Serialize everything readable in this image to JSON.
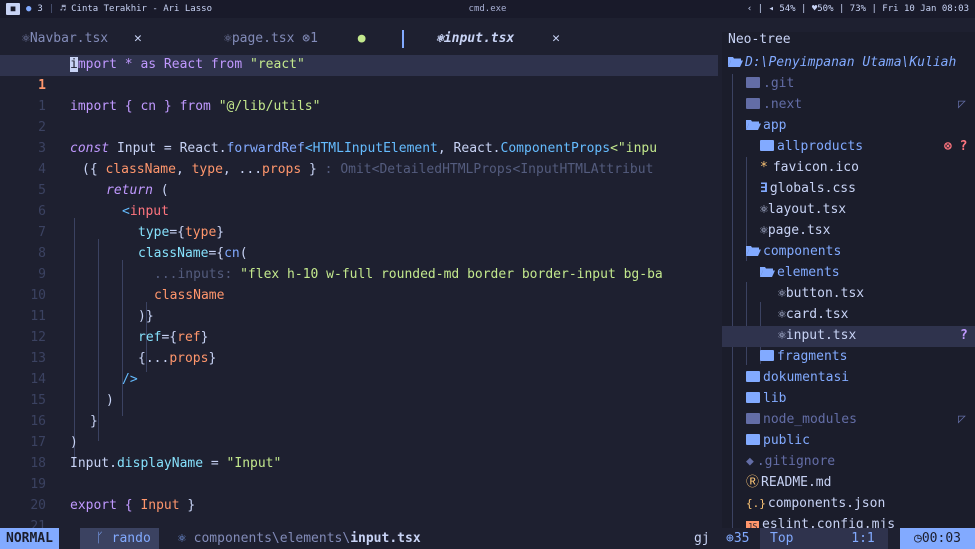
{
  "topbar": {
    "app_icon": "■",
    "dot_icon": "●",
    "workspace": "3",
    "music": "♬ Cinta Terakhir - Ari Lasso",
    "window_title": "cmd.exe",
    "status": "‹ | ◂ 54% | ♥50% | 73% | Fri 10 Jan 08:03"
  },
  "tabs": [
    {
      "icon": "⚛",
      "label": "Navbar.tsx",
      "close": "✕"
    },
    {
      "icon": "⚛",
      "label": "page.tsx",
      "badge": "⊗1",
      "modified": "●"
    },
    {
      "icon": "⚛",
      "label": "input.tsx",
      "close": "✕"
    }
  ],
  "editor": {
    "line_numbers": [
      "1",
      "1",
      "2",
      "3",
      "4",
      "5",
      "6",
      "7",
      "8",
      "9",
      "10",
      "11",
      "12",
      "13",
      "14",
      "15",
      "16",
      "17",
      "18",
      "19",
      "20",
      "21"
    ],
    "l1a": "i",
    "l1b": "mport * as React from ",
    "l1c": "\"react\"",
    "l3a": "import { cn } from ",
    "l3b": "\"@/lib/utils\"",
    "l5a": "const",
    "l5b": " Input = React.",
    "l5c": "forwardRef",
    "l5d": "<",
    "l5e": "HTMLInputElement",
    "l5f": ", React.",
    "l5g": "ComponentProps",
    "l5h": "<\"inpu",
    "l6a": "({ ",
    "l6b": "className",
    "l6c": ", ",
    "l6d": "type",
    "l6e": ", ...",
    "l6f": "props",
    "l6g": " } ",
    "l6h": ": Omit<DetailedHTMLProps<InputHTMLAttribut",
    "l7a": "return",
    "l7b": " (",
    "l8a": "<",
    "l8b": "input",
    "l9a": "type",
    "l9b": "={",
    "l9c": "type",
    "l9d": "}",
    "l10a": "className",
    "l10b": "={",
    "l10c": "cn",
    "l10d": "(",
    "l11a": "...inputs: ",
    "l11b": "\"flex h-10 w-full rounded-md border border-input bg-ba",
    "l12a": "className",
    "l13a": ")}",
    "l14a": "ref",
    "l14b": "={",
    "l14c": "ref",
    "l14d": "}",
    "l15a": "{...",
    "l15b": "props",
    "l15c": "}",
    "l16a": "/>",
    "l17a": ")",
    "l18a": "}",
    "l19a": ")",
    "l20a": "Input.",
    "l20b": "displayName",
    "l20c": " = ",
    "l20d": "\"Input\"",
    "l22a": "export { ",
    "l22b": "Input",
    "l22c": " }"
  },
  "tree": {
    "title": "Neo-tree",
    "root": "D:\\Penyimpanan Utama\\Kuliah",
    "items": [
      {
        "label": ".git"
      },
      {
        "label": ".next"
      },
      {
        "label": "app"
      },
      {
        "label": "allproducts"
      },
      {
        "label": "favicon.ico"
      },
      {
        "label": "globals.css"
      },
      {
        "label": "layout.tsx"
      },
      {
        "label": "page.tsx"
      },
      {
        "label": "components"
      },
      {
        "label": "elements"
      },
      {
        "label": "button.tsx"
      },
      {
        "label": "card.tsx"
      },
      {
        "label": "input.tsx"
      },
      {
        "label": "fragments"
      },
      {
        "label": "dokumentasi"
      },
      {
        "label": "lib"
      },
      {
        "label": "node_modules"
      },
      {
        "label": "public"
      },
      {
        "label": ".gitignore"
      },
      {
        "label": "README.md"
      },
      {
        "label": "components.json"
      },
      {
        "label": "eslint.config.mjs"
      }
    ],
    "git_badge_allproducts": "⊗ ?",
    "git_badge_input": "?",
    "ignored_marker": "◸"
  },
  "status": {
    "mode": "NORMAL",
    "branch_icon": "ᚴ",
    "branch": "rando",
    "file_icon": "⚛",
    "path_prefix": "components\\elements\\",
    "path_file": "input.tsx",
    "keys": "gj",
    "lsp": "⊕35",
    "position": "Top",
    "cursor": "1:1",
    "clock": "◷00:03"
  },
  "colors": {
    "accent": "#82aaff",
    "bg": "#1e2030",
    "string": "#c3e88d",
    "keyword": "#c099ff",
    "error": "#ff757f",
    "warning": "#ffc777"
  }
}
